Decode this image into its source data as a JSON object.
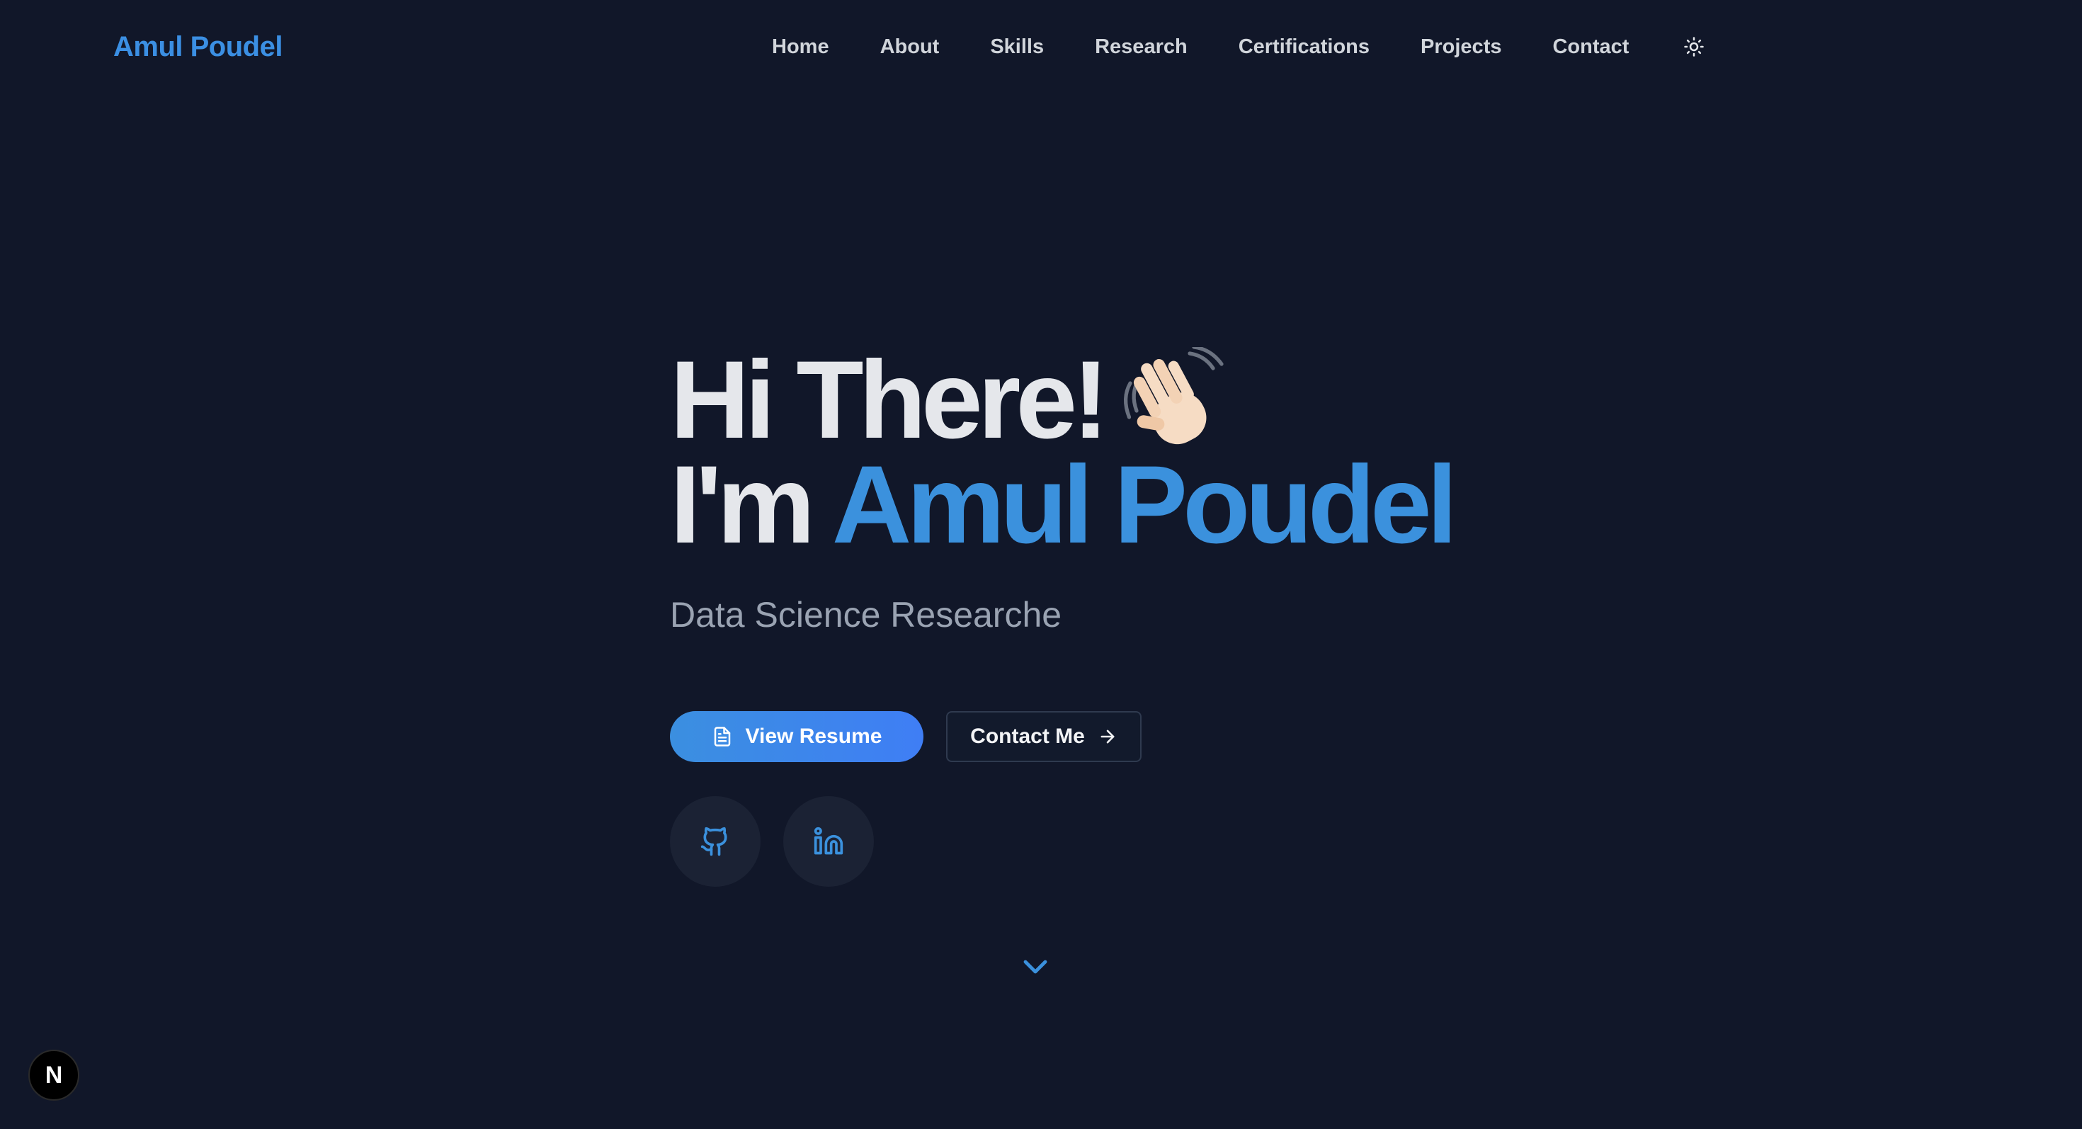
{
  "brand": {
    "name": "Amul Poudel",
    "color": "#3b8fe3"
  },
  "nav": {
    "items": [
      {
        "label": "Home"
      },
      {
        "label": "About"
      },
      {
        "label": "Skills"
      },
      {
        "label": "Research"
      },
      {
        "label": "Certifications"
      },
      {
        "label": "Projects"
      },
      {
        "label": "Contact"
      }
    ],
    "theme_toggle_icon": "sun-icon"
  },
  "hero": {
    "greeting": "Hi There!",
    "greeting_emoji_icon": "waving-hand-icon",
    "intro_prefix": "I'm",
    "name": "Amul Poudel",
    "subtitle": "Data Science Researche",
    "accent_color": "#3b91dd"
  },
  "actions": {
    "primary_label": "View Resume",
    "primary_icon": "document-icon",
    "secondary_label": "Contact Me",
    "secondary_icon": "arrow-right-icon"
  },
  "socials": [
    {
      "icon": "github-icon"
    },
    {
      "icon": "linkedin-icon"
    }
  ],
  "scroll_indicator_icon": "chevron-down-icon",
  "dev_badge": {
    "label": "N",
    "icon": "nextjs-icon"
  },
  "colors": {
    "background": "#111729",
    "heading": "#e5e7eb",
    "subtitle": "#9aa3b2",
    "button_gradient_start": "#3b8fe0",
    "button_gradient_end": "#3f7ef5"
  }
}
